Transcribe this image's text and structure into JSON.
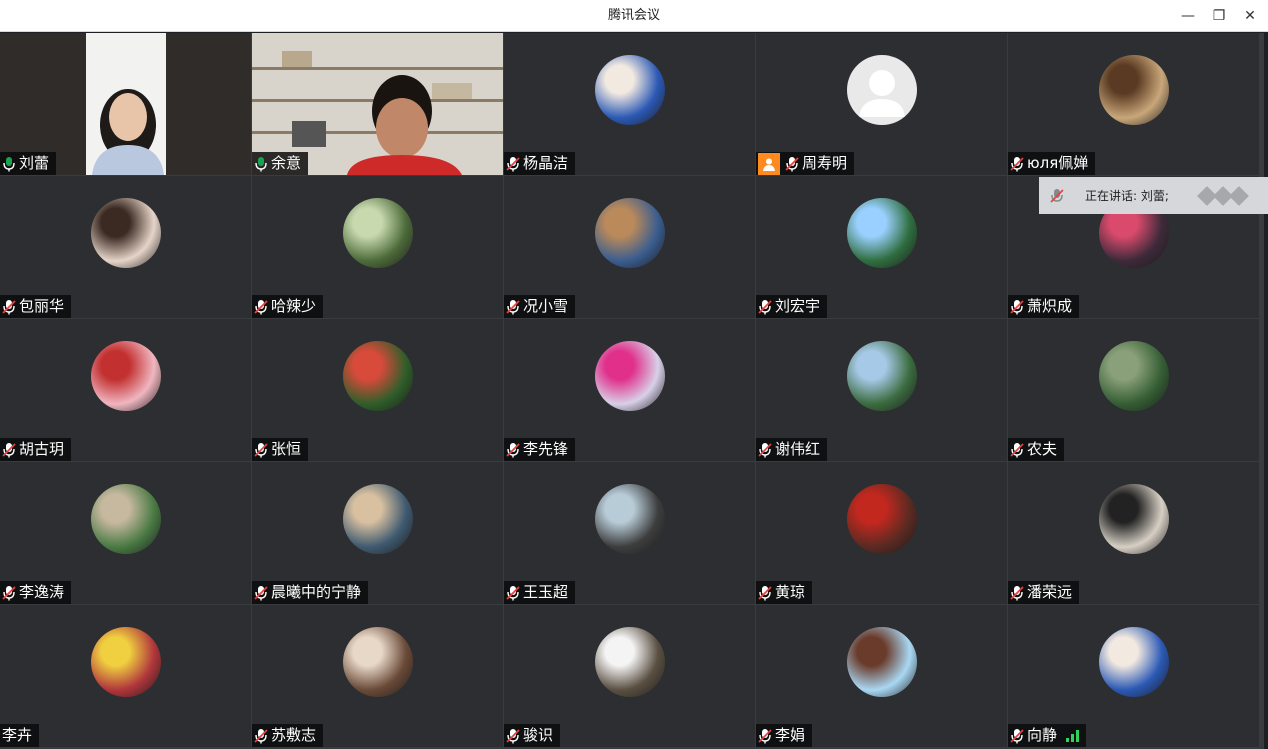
{
  "window": {
    "title": "腾讯会议",
    "minimize": "—",
    "restore": "❐",
    "close": "✕"
  },
  "speaking_indicator": {
    "label": "正在讲话: 刘蕾;"
  },
  "colors": {
    "active_border": "#1aa351",
    "mic_on": "#1aa351",
    "mic_muted": "#e64040",
    "host_badge": "#ff8a1f"
  },
  "participants": [
    {
      "name": "刘蕾",
      "mic": "on",
      "kind": "video"
    },
    {
      "name": "余意",
      "mic": "on",
      "kind": "video"
    },
    {
      "name": "杨晶洁",
      "mic": "muted",
      "kind": "avatar"
    },
    {
      "name": "周寿明",
      "mic": "muted",
      "kind": "default-avatar",
      "host": true
    },
    {
      "name": "юля佩婵",
      "mic": "muted",
      "kind": "avatar"
    },
    {
      "name": "包丽华",
      "mic": "muted",
      "kind": "avatar"
    },
    {
      "name": "哈辣少",
      "mic": "muted",
      "kind": "avatar"
    },
    {
      "name": "况小雪",
      "mic": "muted",
      "kind": "avatar"
    },
    {
      "name": "刘宏宇",
      "mic": "muted",
      "kind": "avatar"
    },
    {
      "name": "萧炽成",
      "mic": "muted",
      "kind": "avatar"
    },
    {
      "name": "胡古玥",
      "mic": "muted",
      "kind": "avatar"
    },
    {
      "name": "张恒",
      "mic": "muted",
      "kind": "avatar"
    },
    {
      "name": "李先锋",
      "mic": "muted",
      "kind": "avatar"
    },
    {
      "name": "谢伟红",
      "mic": "muted",
      "kind": "avatar"
    },
    {
      "name": "农夫",
      "mic": "muted",
      "kind": "avatar"
    },
    {
      "name": "李逸涛",
      "mic": "muted",
      "kind": "avatar"
    },
    {
      "name": "晨曦中的宁静",
      "mic": "muted",
      "kind": "avatar"
    },
    {
      "name": "王玉超",
      "mic": "muted",
      "kind": "avatar"
    },
    {
      "name": "黄琼",
      "mic": "muted",
      "kind": "avatar"
    },
    {
      "name": "潘荣远",
      "mic": "muted",
      "kind": "avatar"
    },
    {
      "name": "李卉",
      "mic": "none",
      "kind": "avatar"
    },
    {
      "name": "苏敷志",
      "mic": "muted",
      "kind": "avatar"
    },
    {
      "name": "骏识",
      "mic": "muted",
      "kind": "avatar"
    },
    {
      "name": "李娟",
      "mic": "muted",
      "kind": "avatar"
    },
    {
      "name": "向静",
      "mic": "muted",
      "kind": "avatar",
      "signal": true
    }
  ]
}
